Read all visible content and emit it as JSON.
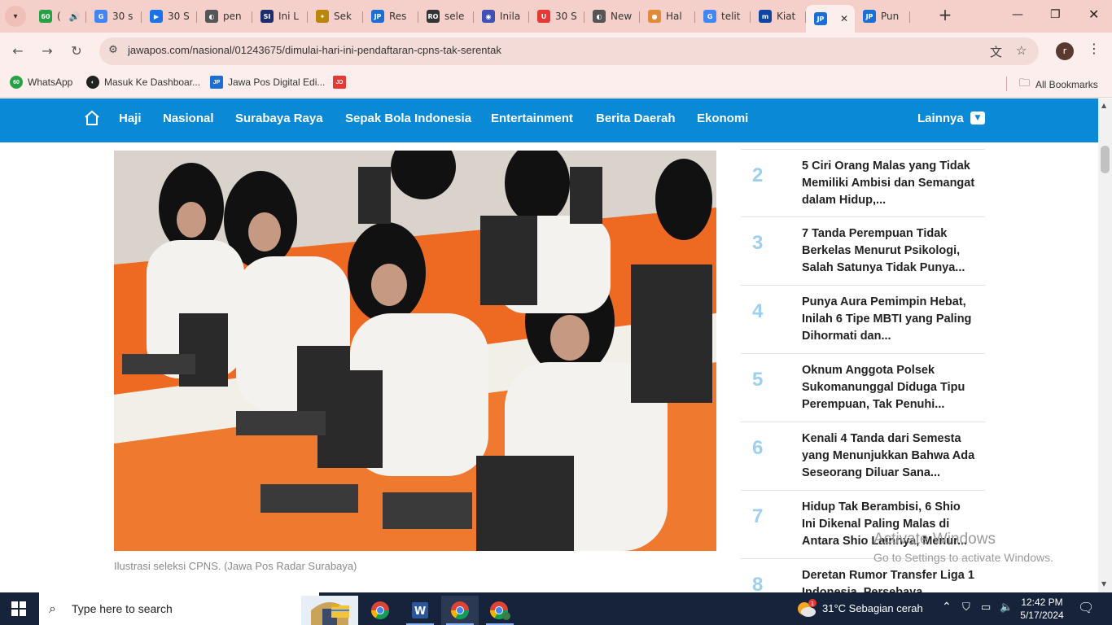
{
  "browser": {
    "tabs": [
      {
        "label": "(",
        "fav": "60",
        "color": "#25a244",
        "audio": true
      },
      {
        "label": "30 s",
        "fav": "G",
        "color": "#4285f4"
      },
      {
        "label": "30 S",
        "fav": "▶",
        "color": "#1a73e8"
      },
      {
        "label": "pen",
        "fav": "◐",
        "color": "#555555"
      },
      {
        "label": "Ini L",
        "fav": "SI",
        "color": "#1c2e6e"
      },
      {
        "label": "Sek",
        "fav": "✦",
        "color": "#b8860b"
      },
      {
        "label": "Res",
        "fav": "JP",
        "color": "#1a6fd6"
      },
      {
        "label": "sele",
        "fav": "RO",
        "color": "#333333"
      },
      {
        "label": "Inila",
        "fav": "◉",
        "color": "#3f51b5"
      },
      {
        "label": "30 S",
        "fav": "U",
        "color": "#e53935"
      },
      {
        "label": "New",
        "fav": "◐",
        "color": "#555555"
      },
      {
        "label": "Hal",
        "fav": "●",
        "color": "#e08a3a"
      },
      {
        "label": "telit",
        "fav": "G",
        "color": "#4285f4"
      },
      {
        "label": "Kiat",
        "fav": "m",
        "color": "#0d47a1"
      },
      {
        "label": "",
        "fav": "JP",
        "color": "#1a6fd6",
        "active": true
      },
      {
        "label": "Pun",
        "fav": "JP",
        "color": "#1a6fd6"
      }
    ],
    "url": "jawapos.com/nasional/01243675/dimulai-hari-ini-pendaftaran-cpns-tak-serentak",
    "profile_initial": "r",
    "bookmarks": [
      {
        "label": "WhatsApp",
        "icon": "60",
        "color": "#25a244"
      },
      {
        "label": "Masuk Ke Dashboar...",
        "icon": "◐",
        "color": "#222222"
      },
      {
        "label": "Jawa Pos Digital Edi...",
        "icon": "JP",
        "color": "#1a6fd6"
      },
      {
        "label": "",
        "icon": "JD",
        "color": "#e53935"
      }
    ],
    "all_bookmarks": "All Bookmarks"
  },
  "site": {
    "nav": [
      "Haji",
      "Nasional",
      "Surabaya Raya",
      "Sepak Bola Indonesia",
      "Entertainment",
      "Berita Daerah",
      "Ekonomi"
    ],
    "more": "Lainnya",
    "brand_color": "#0a8ad6",
    "image_caption": "Ilustrasi seleksi CPNS. (Jawa Pos Radar Surabaya)",
    "popular": [
      {
        "num": "2",
        "title": "5 Ciri Orang Malas yang Tidak Memiliki Ambisi dan Semangat dalam Hidup,..."
      },
      {
        "num": "3",
        "title": "7 Tanda Perempuan Tidak Berkelas Menurut Psikologi, Salah Satunya Tidak Punya..."
      },
      {
        "num": "4",
        "title": "Punya Aura Pemimpin Hebat, Inilah 6 Tipe MBTI yang Paling Dihormati dan..."
      },
      {
        "num": "5",
        "title": "Oknum Anggota Polsek Sukomanunggal Diduga Tipu Perempuan, Tak Penuhi..."
      },
      {
        "num": "6",
        "title": "Kenali 4 Tanda dari Semesta yang Menunjukkan Bahwa Ada Seseorang Diluar Sana..."
      },
      {
        "num": "7",
        "title": "Hidup Tak Berambisi, 6 Shio Ini Dikenal Paling Malas di Antara Shio Lainnya, Menur..."
      },
      {
        "num": "8",
        "title": "Deretan Rumor Transfer Liga 1 Indonesia, Persebaya..."
      }
    ]
  },
  "watermark": {
    "line1": "Activate Windows",
    "line2": "Go to Settings to activate Windows."
  },
  "taskbar": {
    "search_placeholder": "Type here to search",
    "weather": "31°C  Sebagian cerah",
    "weather_badge": "1",
    "time": "12:42 PM",
    "date": "5/17/2024"
  }
}
